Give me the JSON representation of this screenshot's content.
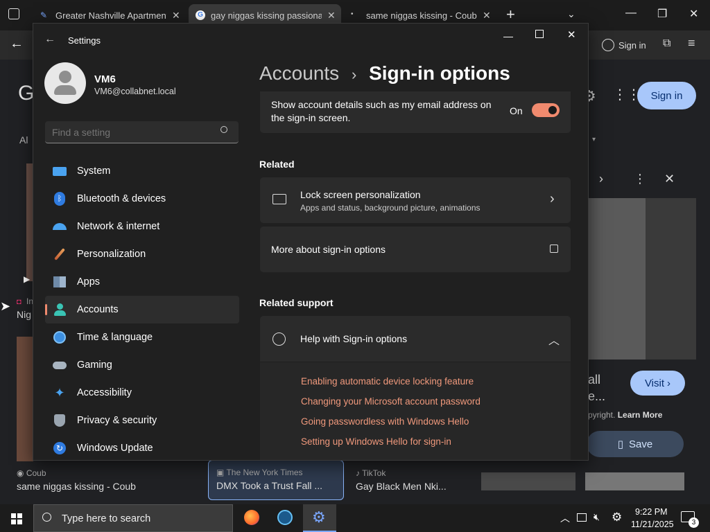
{
  "browser": {
    "tabs": [
      {
        "title": "Greater Nashville Apartment As"
      },
      {
        "title": "gay niggas kissing passionately"
      },
      {
        "title": "same niggas kissing - Coub"
      }
    ],
    "signin_top": "Sign in",
    "signin_button": "Sign in",
    "filter_left": "Al",
    "results": [
      {
        "source": "Coub",
        "title": "same niggas kissing - Coub"
      },
      {
        "source": "The New York Times",
        "title": "DMX Took a Trust Fall ..."
      },
      {
        "source": "TikTok",
        "title": "Gay Black Men Nki..."
      }
    ],
    "side_text_1": "Nig",
    "side_text_2": "In",
    "panel": {
      "title_frag_1": "all",
      "title_frag_2": "e...",
      "copyright": "pyright.",
      "learn_more": "Learn More",
      "visit": "Visit",
      "save": "Save"
    }
  },
  "settings": {
    "title": "Settings",
    "user": {
      "name": "VM6",
      "email": "VM6@collabnet.local"
    },
    "search_placeholder": "Find a setting",
    "nav": [
      {
        "label": "System",
        "icon": "monitor-icon"
      },
      {
        "label": "Bluetooth & devices",
        "icon": "bluetooth-icon"
      },
      {
        "label": "Network & internet",
        "icon": "wifi-icon"
      },
      {
        "label": "Personalization",
        "icon": "brush-icon"
      },
      {
        "label": "Apps",
        "icon": "apps-icon"
      },
      {
        "label": "Accounts",
        "icon": "person-icon"
      },
      {
        "label": "Time & language",
        "icon": "globe-clock-icon"
      },
      {
        "label": "Gaming",
        "icon": "gamepad-icon"
      },
      {
        "label": "Accessibility",
        "icon": "accessibility-icon"
      },
      {
        "label": "Privacy & security",
        "icon": "shield-icon"
      },
      {
        "label": "Windows Update",
        "icon": "update-icon"
      }
    ],
    "breadcrumb": {
      "parent": "Accounts",
      "sep": "›",
      "current": "Sign-in options"
    },
    "account_details": {
      "text": "Show account details such as my email address on the sign-in screen.",
      "state": "On"
    },
    "related_heading": "Related",
    "lock_screen": {
      "title": "Lock screen personalization",
      "subtitle": "Apps and status, background picture, animations"
    },
    "more_signin": "More about sign-in options",
    "related_support_heading": "Related support",
    "help": {
      "title": "Help with Sign-in options",
      "links": [
        "Enabling automatic device locking feature",
        "Changing your Microsoft account password",
        "Going passwordless with Windows Hello",
        "Setting up Windows Hello for sign-in"
      ]
    }
  },
  "taskbar": {
    "search_placeholder": "Type here to search",
    "time": "9:22 PM",
    "date": "11/21/2025",
    "notification_count": "3"
  },
  "colors": {
    "accent": "#f08a6e",
    "link": "#f0997c",
    "window_bg": "#202020",
    "card_bg": "#2b2b2b"
  }
}
